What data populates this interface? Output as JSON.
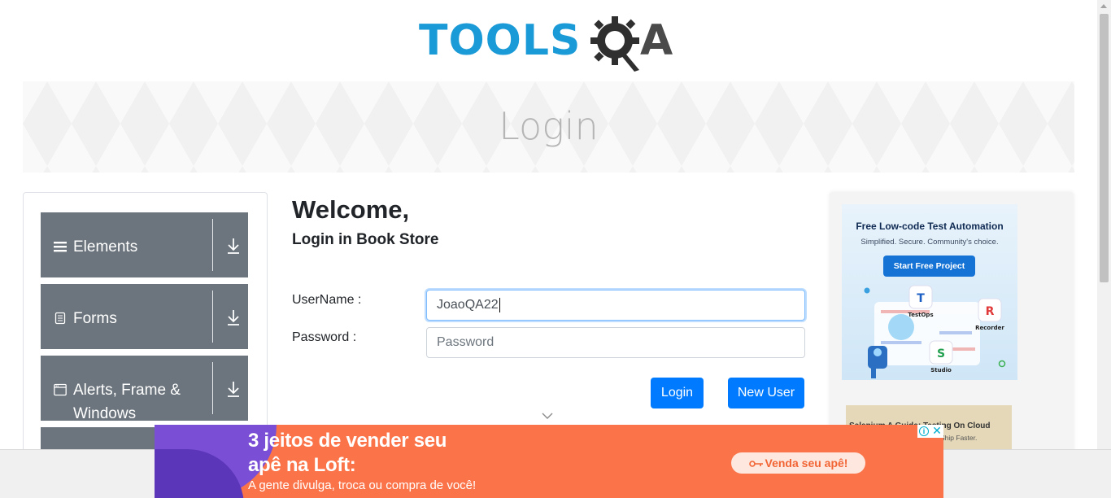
{
  "header": {
    "logo_text": "TOOLS",
    "logo_letter": "A"
  },
  "banner": {
    "title": "Login"
  },
  "sidebar": {
    "groups": [
      {
        "label": "Elements",
        "icon": "hamburger-icon"
      },
      {
        "label": "Forms",
        "icon": "document-icon"
      },
      {
        "label": "Alerts, Frame & Windows",
        "icon": "window-icon"
      }
    ]
  },
  "login": {
    "welcome": "Welcome,",
    "subtitle": "Login in Book Store",
    "username_label": "UserName :",
    "username_value": "JoaoQA22",
    "password_label": "Password :",
    "password_placeholder": "Password",
    "login_button": "Login",
    "new_user_button": "New User"
  },
  "right_ad": {
    "title": "Free Low-code Test Automation",
    "subtitle": "Simplified. Secure. Community's choice.",
    "button": "Start Free Project",
    "nodes": [
      "TestOps",
      "Recorder",
      "Studio"
    ],
    "card2_title": "Selenium A Guide: Testing On Cloud",
    "card2_sub": "Ship Faster."
  },
  "bottom_ad": {
    "line1": "3 jeitos de vender seu",
    "line2": "apê na Loft:",
    "line3": "A gente divulga, troca ou compra de você!",
    "cta": "Venda seu apê!",
    "info": "i",
    "close": "✕"
  },
  "colors": {
    "accent": "#007bff",
    "menu_group": "#6c757d",
    "logo_blue": "#1a9ad6",
    "ad_orange": "#fb7449"
  }
}
